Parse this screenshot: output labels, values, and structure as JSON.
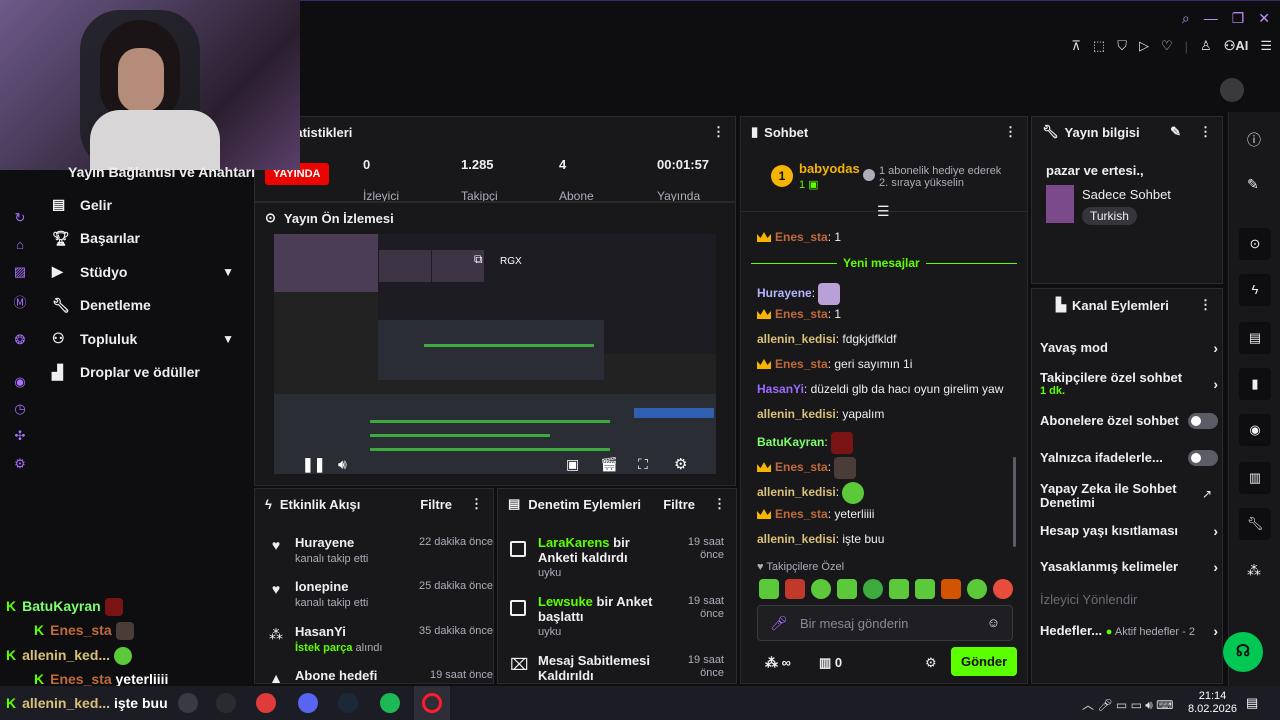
{
  "stats": {
    "title": "ın İstatistikleri",
    "live_badge": "YAYINDA",
    "viewers": "0",
    "viewers_label": "İzleyici",
    "followers": "1.285",
    "followers_label": "Takipçi",
    "subs": "4",
    "subs_label": "Abone",
    "uptime": "00:01:57",
    "uptime_label": "Yayında"
  },
  "leftnav": {
    "partial": "Yayın Bağlantısı ve Anahtarı",
    "items": [
      {
        "label": "Gelir"
      },
      {
        "label": "Başarılar"
      },
      {
        "label": "Stüdyo"
      },
      {
        "label": "Denetleme"
      },
      {
        "label": "Topluluk"
      },
      {
        "label": "Droplar ve ödüller"
      }
    ]
  },
  "preview": {
    "title": "Yayın Ön İzlemesi",
    "rgx": "RGX"
  },
  "activity": {
    "title": "Etkinlik Akışı",
    "filter": "Filtre",
    "items": [
      {
        "name": "Hurayene",
        "sub": "kanalı takip etti",
        "time": "22 dakika önce"
      },
      {
        "name": "lonepine",
        "sub": "kanalı takip etti",
        "time": "25 dakika önce"
      },
      {
        "name": "HasanYi",
        "sub_g": "İstek parça",
        "sub": " alındı",
        "time": "35 dakika önce"
      },
      {
        "name": "Abone hedefi",
        "time": "19 saat önce"
      }
    ]
  },
  "modactions": {
    "title": "Denetim Eylemleri",
    "filter": "Filtre",
    "items": [
      {
        "user": "LaraKarens",
        "rest": " bir Anketi kaldırdı",
        "sub": "uyku",
        "time1": "19 saat",
        "time2": "önce"
      },
      {
        "user": "Lewsuke",
        "rest": " bir Anket başlattı",
        "sub": "uyku",
        "time1": "19 saat",
        "time2": "önce"
      },
      {
        "user": "",
        "rest": "Mesaj Sabitlemesi Kaldırıldı",
        "sub": "",
        "time1": "19 saat",
        "time2": "önce"
      }
    ]
  },
  "chat": {
    "title": "Sohbet",
    "pinned_user": "babyodas",
    "pinned_count": "1",
    "gift_line1": "1 abonelik hediye ederek",
    "gift_line2": "2. sıraya yükselin",
    "new_messages": "Yeni mesajlar",
    "messages": [
      {
        "user": "Enes_sta",
        "text": ": 1"
      },
      {
        "user": "Hurayene",
        "text": ":"
      },
      {
        "user": "Enes_sta",
        "text": ": 1"
      },
      {
        "user": "allenin_kedisi",
        "text": ": fdgkjdfkldf"
      },
      {
        "user": "Enes_sta",
        "text": ": geri sayımın 1i"
      },
      {
        "user": "HasanYi",
        "text": ": düzeldi glb da hacı oyun girelim yaw"
      },
      {
        "user": "allenin_kedisi",
        "text": ": yapalım"
      },
      {
        "user": "BatuKayran",
        "text": ":"
      },
      {
        "user": "Enes_sta",
        "text": ":"
      },
      {
        "user": "allenin_kedisi",
        "text": ":"
      },
      {
        "user": "Enes_sta",
        "text": ": yeterliiii"
      },
      {
        "user": "allenin_kedisi",
        "text": ": işte buu"
      }
    ],
    "follower_special": "Takipçilere Özel",
    "input_placeholder": "Bir mesaj gönderin",
    "points": "0",
    "send": "Gönder"
  },
  "streaminfo": {
    "title": "Yayın bilgisi",
    "stream_title": "pazar ve ertesi.,",
    "category": "Sadece Sohbet",
    "tag": "Turkish"
  },
  "channelactions": {
    "title": "Kanal Eylemleri",
    "items": [
      {
        "label": "Yavaş mod"
      },
      {
        "label": "Takipçilere özel sohbet",
        "sub": "1 dk."
      },
      {
        "label": "Abonelere özel sohbet"
      },
      {
        "label": "Yalnızca ifadelerle..."
      },
      {
        "label": "Yapay Zeka ile Sohbet Denetimi"
      },
      {
        "label": "Hesap yaşı kısıtlaması"
      },
      {
        "label": "Yasaklanmış kelimeler"
      },
      {
        "label": "İzleyici Yönlendir"
      },
      {
        "label": "Hedefler...",
        "sub": "Aktif hedefler - 2"
      }
    ]
  },
  "toolbar": {
    "ai": "AI"
  },
  "overlay": {
    "lines": [
      {
        "user": "BatuKayran",
        "text": ""
      },
      {
        "user": "Enes_sta",
        "text": ""
      },
      {
        "user": "allenin_ked...",
        "text": ""
      },
      {
        "user": "Enes_sta",
        "text": "yeterliiii"
      },
      {
        "user": "allenin_ked...",
        "text": "işte buu"
      }
    ]
  },
  "taskbar": {
    "time": "21:14",
    "date": "8.02.2026"
  },
  "colors": {
    "accent": "#bf94ff",
    "green": "#5cff00",
    "live": "#eb0400",
    "crown": "#f5b400"
  }
}
